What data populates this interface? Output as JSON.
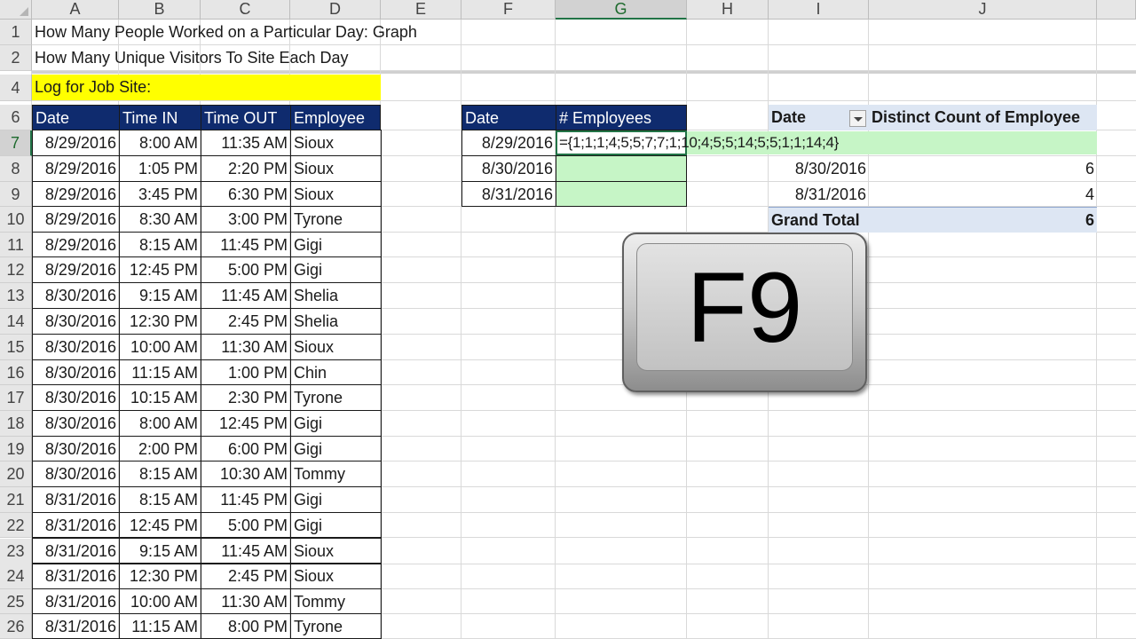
{
  "columns": [
    "A",
    "B",
    "C",
    "D",
    "E",
    "F",
    "G",
    "H",
    "I",
    "J"
  ],
  "rows": [
    "1",
    "2",
    "4",
    "6",
    "7",
    "8",
    "9",
    "10",
    "11",
    "12",
    "13",
    "14",
    "15",
    "16",
    "17",
    "18",
    "19",
    "20",
    "21",
    "22",
    "23",
    "24",
    "25",
    "26"
  ],
  "titles": {
    "row1": "How Many People Worked on a Particular Day: Graph",
    "row2": "How Many Unique Visitors To Site Each Day",
    "log_label": "Log for Job Site:"
  },
  "log_table": {
    "headers": [
      "Date",
      "Time IN",
      "Time OUT",
      "Employee"
    ],
    "rows": [
      [
        "8/29/2016",
        "8:00 AM",
        "11:35 AM",
        "Sioux"
      ],
      [
        "8/29/2016",
        "1:05 PM",
        "2:20 PM",
        "Sioux"
      ],
      [
        "8/29/2016",
        "3:45 PM",
        "6:30 PM",
        "Sioux"
      ],
      [
        "8/29/2016",
        "8:30 AM",
        "3:00 PM",
        "Tyrone"
      ],
      [
        "8/29/2016",
        "8:15 AM",
        "11:45 PM",
        "Gigi"
      ],
      [
        "8/29/2016",
        "12:45 PM",
        "5:00 PM",
        "Gigi"
      ],
      [
        "8/30/2016",
        "9:15 AM",
        "11:45 AM",
        "Shelia"
      ],
      [
        "8/30/2016",
        "12:30 PM",
        "2:45 PM",
        "Shelia"
      ],
      [
        "8/30/2016",
        "10:00 AM",
        "11:30 AM",
        "Sioux"
      ],
      [
        "8/30/2016",
        "11:15 AM",
        "1:00 PM",
        "Chin"
      ],
      [
        "8/30/2016",
        "10:15 AM",
        "2:30 PM",
        "Tyrone"
      ],
      [
        "8/30/2016",
        "8:00 AM",
        "12:45 PM",
        "Gigi"
      ],
      [
        "8/30/2016",
        "2:00 PM",
        "6:00 PM",
        "Gigi"
      ],
      [
        "8/30/2016",
        "8:15 AM",
        "10:30 AM",
        "Tommy"
      ],
      [
        "8/31/2016",
        "8:15 AM",
        "11:45 PM",
        "Gigi"
      ],
      [
        "8/31/2016",
        "12:45 PM",
        "5:00 PM",
        "Gigi"
      ],
      [
        "8/31/2016",
        "9:15 AM",
        "11:45 AM",
        "Sioux"
      ],
      [
        "8/31/2016",
        "12:30 PM",
        "2:45 PM",
        "Sioux"
      ],
      [
        "8/31/2016",
        "10:00 AM",
        "11:30 AM",
        "Tommy"
      ],
      [
        "8/31/2016",
        "11:15 AM",
        "8:00 PM",
        "Tyrone"
      ]
    ]
  },
  "summary_table": {
    "headers": [
      "Date",
      "# Employees"
    ],
    "dates": [
      "8/29/2016",
      "8/30/2016",
      "8/31/2016"
    ],
    "formula": "={1;1;1;4;5;5;7;7;1;10;4;5;5;14;5;5;1;1;14;4}"
  },
  "pivot": {
    "headers": [
      "Date",
      "Distinct Count of Employee"
    ],
    "rows": [
      [
        "8/30/2016",
        "6"
      ],
      [
        "8/31/2016",
        "4"
      ]
    ],
    "total_label": "Grand Total",
    "total_value": "6"
  },
  "key_overlay": {
    "label": "F9"
  },
  "colors": {
    "header_fill": "#0f2b6e",
    "highlight_yellow": "#ffff00",
    "green_fill": "#c6f5c6",
    "pivot_fill": "#dde6f3",
    "selection": "#217346"
  }
}
